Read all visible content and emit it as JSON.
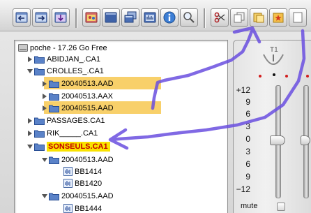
{
  "toolbar": {
    "buttons": [
      {
        "name": "import-left-button",
        "icon": "window-arrow-left-icon"
      },
      {
        "name": "import-right-button",
        "icon": "window-arrow-right-icon"
      },
      {
        "name": "export-button",
        "icon": "window-arrow-down-icon"
      },
      {
        "name": "media-button",
        "icon": "media-window-icon"
      },
      {
        "name": "window-button",
        "icon": "blue-window-icon"
      },
      {
        "name": "multi-window-button",
        "icon": "stacked-windows-icon"
      },
      {
        "name": "audio-window-button",
        "icon": "audio-window-icon"
      },
      {
        "name": "info-button",
        "icon": "info-icon"
      },
      {
        "name": "search-button",
        "icon": "magnifier-icon"
      },
      {
        "name": "cut-button",
        "icon": "scissors-icon"
      },
      {
        "name": "copy-button",
        "icon": "copy-pages-icon"
      },
      {
        "name": "paste-button",
        "icon": "paste-folder-icon"
      },
      {
        "name": "new-item-button",
        "icon": "star-folder-icon"
      }
    ]
  },
  "tree": {
    "root_label": "poche - 17.26 Go Free",
    "items": [
      {
        "label": "ABIDJAN_.CA1",
        "level": 1,
        "expanded": false,
        "kind": "folder"
      },
      {
        "label": "CROLLES_.CA1",
        "level": 1,
        "expanded": true,
        "kind": "folder"
      },
      {
        "label": "20040513.AAD",
        "level": 2,
        "expanded": false,
        "kind": "folder",
        "highlight": "orange"
      },
      {
        "label": "20040513.AAX",
        "level": 2,
        "expanded": false,
        "kind": "folder"
      },
      {
        "label": "20040515.AAD",
        "level": 2,
        "expanded": false,
        "kind": "folder",
        "highlight": "orange"
      },
      {
        "label": "PASSAGES.CA1",
        "level": 1,
        "expanded": false,
        "kind": "folder"
      },
      {
        "label": "RIK_____.CA1",
        "level": 1,
        "expanded": false,
        "kind": "folder"
      },
      {
        "label": "SONSEULS.CA1",
        "level": 1,
        "expanded": true,
        "kind": "folder",
        "highlight": "yellow"
      },
      {
        "label": "20040513.AAD",
        "level": 2,
        "expanded": true,
        "kind": "folder"
      },
      {
        "label": "BB1414",
        "level": 3,
        "kind": "audio"
      },
      {
        "label": "BB1420",
        "level": 3,
        "kind": "audio"
      },
      {
        "label": "20040515.AAD",
        "level": 2,
        "expanded": true,
        "kind": "folder"
      },
      {
        "label": "BB1444",
        "level": 3,
        "kind": "audio"
      }
    ]
  },
  "mixer": {
    "track_label": "T1",
    "scale": [
      "+12",
      "9",
      "6",
      "3",
      "0",
      "3",
      "6",
      "9",
      "−12"
    ],
    "fader_db": 0,
    "mute_label": "mute",
    "mute_checked": false
  },
  "colors": {
    "highlight_orange": "#f8d06a",
    "highlight_yellow": "#f9e200",
    "highlight_text_red": "#c40000",
    "annotation_stroke": "#6a4fe0"
  }
}
